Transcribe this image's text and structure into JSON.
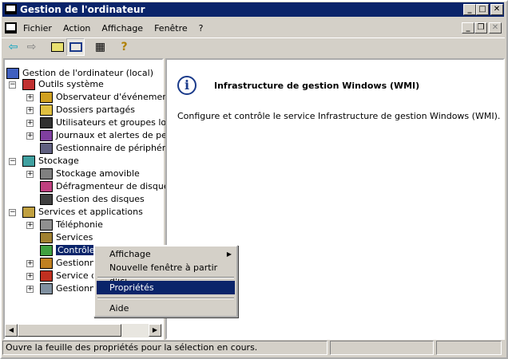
{
  "window": {
    "title": "Gestion de l'ordinateur",
    "minimize": "_",
    "maximize": "□",
    "close": "✕"
  },
  "menu": {
    "items": [
      "Fichier",
      "Action",
      "Affichage",
      "Fenêtre",
      "?"
    ]
  },
  "toolbar": {
    "icons": [
      "back-arrow-icon",
      "forward-arrow-icon",
      "up-folder-icon",
      "show-hide-tree-icon",
      "properties-icon",
      "help-icon"
    ]
  },
  "tree": {
    "items": [
      {
        "label": "Gestion de l'ordinateur (local)",
        "level": 0,
        "expander": "",
        "icon": "computer-icon"
      },
      {
        "label": "Outils système",
        "level": 1,
        "expander": "−",
        "icon": "tools-icon"
      },
      {
        "label": "Observateur d'événements",
        "level": 2,
        "expander": "+",
        "icon": "event-viewer-icon"
      },
      {
        "label": "Dossiers partagés",
        "level": 2,
        "expander": "+",
        "icon": "shared-folder-icon"
      },
      {
        "label": "Utilisateurs et groupes locau",
        "level": 2,
        "expander": "+",
        "icon": "users-icon"
      },
      {
        "label": "Journaux et alertes de perfo",
        "level": 2,
        "expander": "+",
        "icon": "performance-logs-icon"
      },
      {
        "label": "Gestionnaire de périphérique",
        "level": 2,
        "expander": "",
        "icon": "device-manager-icon"
      },
      {
        "label": "Stockage",
        "level": 1,
        "expander": "−",
        "icon": "storage-icon"
      },
      {
        "label": "Stockage amovible",
        "level": 2,
        "expander": "+",
        "icon": "removable-storage-icon"
      },
      {
        "label": "Défragmenteur de disque",
        "level": 2,
        "expander": "",
        "icon": "defrag-icon"
      },
      {
        "label": "Gestion des disques",
        "level": 2,
        "expander": "",
        "icon": "disk-management-icon"
      },
      {
        "label": "Services et applications",
        "level": 1,
        "expander": "−",
        "icon": "services-apps-icon"
      },
      {
        "label": "Téléphonie",
        "level": 2,
        "expander": "+",
        "icon": "telephony-icon"
      },
      {
        "label": "Services",
        "level": 2,
        "expander": "",
        "icon": "services-icon"
      },
      {
        "label": "Contrôle WMI",
        "level": 2,
        "expander": "",
        "icon": "wmi-icon",
        "selected": true
      },
      {
        "label": "Gestionnai",
        "level": 2,
        "expander": "+",
        "icon": "manager-icon"
      },
      {
        "label": "Service d'i",
        "level": 2,
        "expander": "+",
        "icon": "indexing-icon"
      },
      {
        "label": "Gestionnai",
        "level": 2,
        "expander": "+",
        "icon": "server-manager-icon"
      }
    ]
  },
  "context_menu": {
    "items": [
      {
        "label": "Affichage",
        "submenu": true
      },
      {
        "label": "Nouvelle fenêtre à partir d'ici"
      },
      {
        "label": "Propriétés",
        "highlighted": true
      },
      {
        "label": "Aide"
      }
    ]
  },
  "detail": {
    "title": "Infrastructure de gestion Windows (WMI)",
    "description": "Configure et contrôle le service Infrastructure de gestion Windows (WMI)."
  },
  "status": {
    "text": "Ouvre la feuille des propriétés pour la sélection en cours."
  },
  "colors": {
    "titlebar": "#0A246A",
    "face": "#D4D0C8",
    "selection": "#0A246A"
  }
}
